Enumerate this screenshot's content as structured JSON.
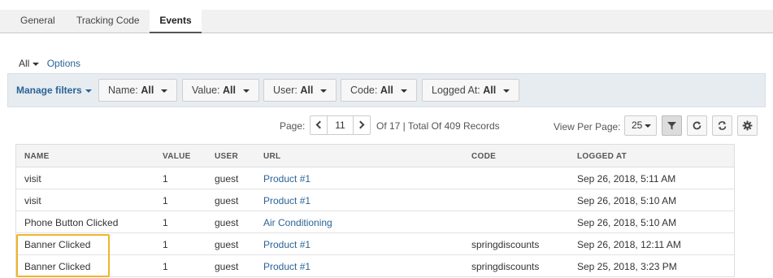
{
  "tabs": [
    "General",
    "Tracking Code",
    "Events"
  ],
  "active_tab": "Events",
  "view": {
    "all_label": "All",
    "options_label": "Options"
  },
  "filters": {
    "manage_label": "Manage filters",
    "items": [
      {
        "name": "Name:",
        "value": "All"
      },
      {
        "name": "Value:",
        "value": "All"
      },
      {
        "name": "User:",
        "value": "All"
      },
      {
        "name": "Code:",
        "value": "All"
      },
      {
        "name": "Logged At:",
        "value": "All"
      }
    ]
  },
  "pager": {
    "label": "Page:",
    "current": "11",
    "summary": "Of 17 | Total Of 409 Records",
    "per_page_label": "View Per Page:",
    "per_page": "25"
  },
  "table": {
    "headers": [
      "NAME",
      "VALUE",
      "USER",
      "URL",
      "CODE",
      "LOGGED AT"
    ],
    "rows": [
      {
        "name": "visit",
        "value": "1",
        "user": "guest",
        "url": "Product #1",
        "code": "",
        "logged_at": "Sep 26, 2018, 5:11 AM"
      },
      {
        "name": "visit",
        "value": "1",
        "user": "guest",
        "url": "Product #1",
        "code": "",
        "logged_at": "Sep 26, 2018, 5:10 AM"
      },
      {
        "name": "Phone Button Clicked",
        "value": "1",
        "user": "guest",
        "url": "Air Conditioning",
        "code": "",
        "logged_at": "Sep 26, 2018, 5:10 AM"
      },
      {
        "name": "Banner Clicked",
        "value": "1",
        "user": "guest",
        "url": "Product #1",
        "code": "springdiscounts",
        "logged_at": "Sep 26, 2018, 12:11 AM"
      },
      {
        "name": "Banner Clicked",
        "value": "1",
        "user": "guest",
        "url": "Product #1",
        "code": "springdiscounts",
        "logged_at": "Sep 25, 2018, 3:23 PM"
      }
    ]
  },
  "colors": {
    "link": "#2a6496",
    "highlight": "#f0b429",
    "filter_bar": "#e7ecf1"
  },
  "icons": [
    "chevron-left-icon",
    "chevron-right-icon",
    "filter-icon",
    "refresh-icon",
    "sync-icon",
    "gear-icon"
  ]
}
